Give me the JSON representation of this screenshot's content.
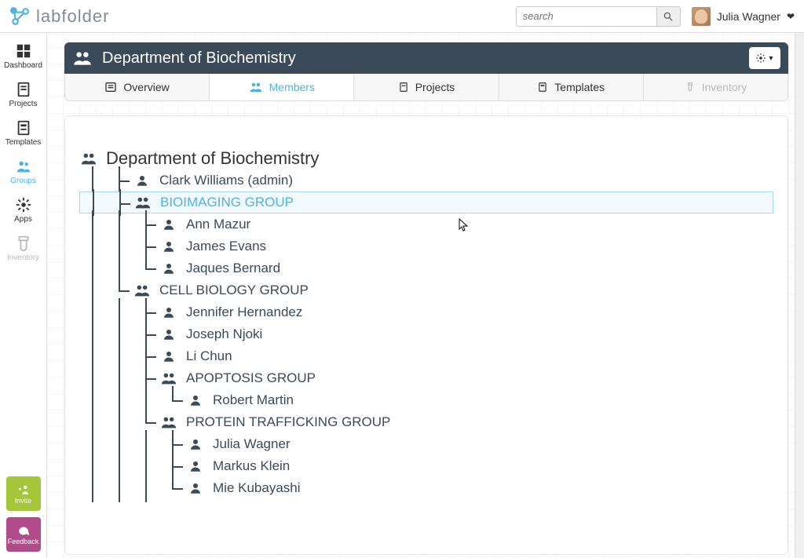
{
  "brand": "labfolder",
  "search": {
    "placeholder": "search"
  },
  "user": {
    "name": "Julia Wagner"
  },
  "sidebar": {
    "items": [
      {
        "label": "Dashboard"
      },
      {
        "label": "Projects"
      },
      {
        "label": "Templates"
      },
      {
        "label": "Groups"
      },
      {
        "label": "Apps"
      },
      {
        "label": "Inventory"
      }
    ],
    "invite_label": "Invite",
    "feedback_label": "Feedback"
  },
  "panel": {
    "title": "Department of Biochemistry",
    "tabs": {
      "overview": "Overview",
      "members": "Members",
      "projects": "Projects",
      "templates": "Templates",
      "inventory": "Inventory"
    }
  },
  "tree": {
    "root": "Department of Biochemistry",
    "admin": "Clark Williams (admin)",
    "groups": [
      {
        "name": "BIOIMAGING GROUP",
        "selected": true,
        "members": [
          "Ann Mazur",
          "James Evans",
          "Jaques Bernard"
        ]
      },
      {
        "name": "CELL BIOLOGY GROUP",
        "members": [
          "Jennifer Hernandez",
          "Joseph Njoki",
          "Li Chun"
        ],
        "subgroups": [
          {
            "name": "APOPTOSIS GROUP",
            "members": [
              "Robert Martin"
            ]
          },
          {
            "name": "PROTEIN TRAFFICKING GROUP",
            "members": [
              "Julia Wagner",
              "Markus Klein",
              "Mie Kubayashi"
            ]
          }
        ]
      }
    ]
  }
}
